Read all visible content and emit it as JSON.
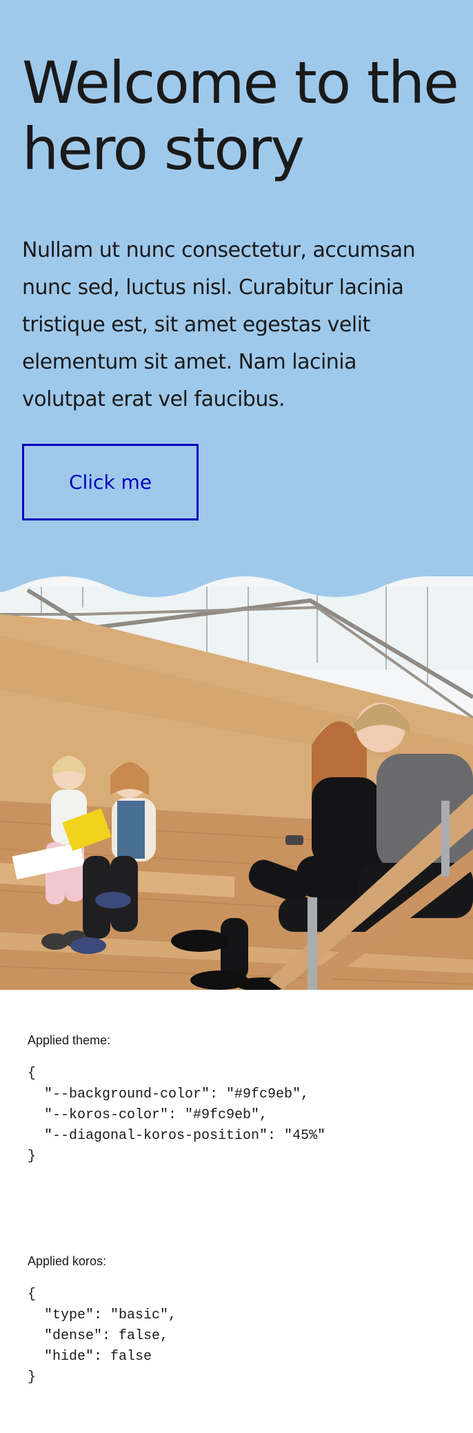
{
  "hero": {
    "title_line1": "Welcome to the",
    "title_line2": "hero story",
    "body_lines": [
      "Nullam ut nunc consectetur, accumsan",
      "nunc sed, luctus nisl. Curabitur lacinia",
      "tristique est, sit amet egestas velit",
      "elementum sit amet. Nam lacinia",
      "volutpat erat vel faucibus."
    ],
    "button_label": "Click me"
  },
  "theme_section": {
    "label": "Applied theme:",
    "code_lines": [
      "{",
      "  \"--background-color\": \"#9fc9eb\",",
      "  \"--koros-color\": \"#9fc9eb\",",
      "  \"--diagonal-koros-position\": \"45%\"",
      "}"
    ]
  },
  "koros_section": {
    "label": "Applied koros:",
    "code_lines": [
      "{",
      "  \"type\": \"basic\",",
      "  \"dense\": false,",
      "  \"hide\": false",
      "}"
    ]
  },
  "colors": {
    "hero_background": "#9fc9eb",
    "button_accent": "#0000bf",
    "text": "#1a1a1a"
  }
}
